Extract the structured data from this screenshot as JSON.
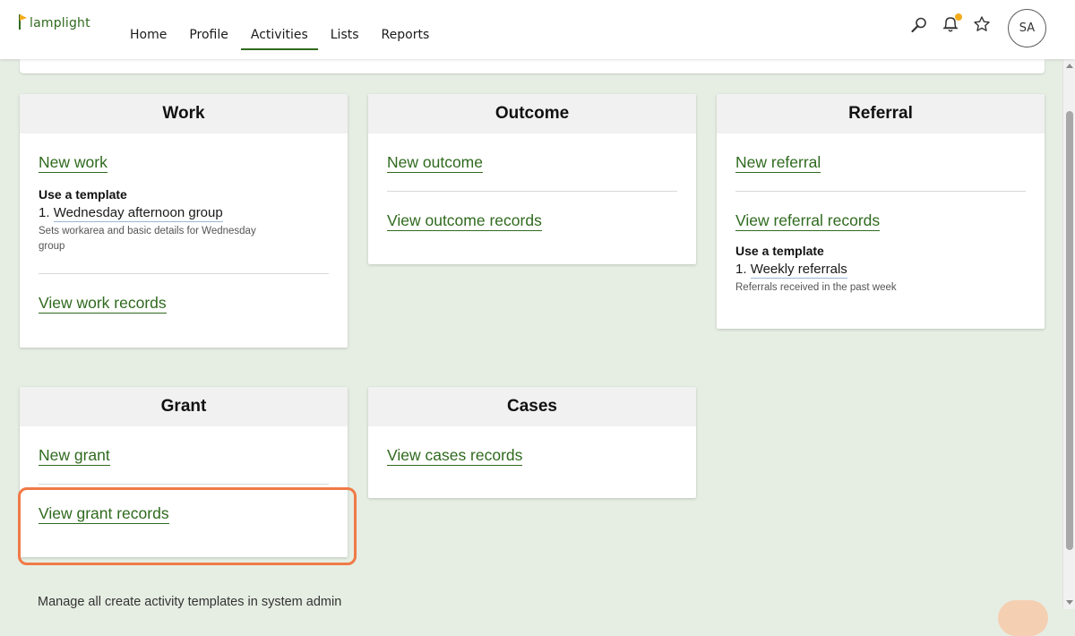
{
  "app": {
    "brand": "lamplight"
  },
  "nav": {
    "items": [
      {
        "label": "Home"
      },
      {
        "label": "Profile"
      },
      {
        "label": "Activities",
        "active": true
      },
      {
        "label": "Lists"
      },
      {
        "label": "Reports"
      }
    ]
  },
  "user": {
    "initials": "SA"
  },
  "colors": {
    "accent": "#2f6a1e",
    "background": "#e6eee3",
    "highlight": "#f07a47",
    "notification": "#f3ac1c"
  },
  "cards": {
    "work": {
      "title": "Work",
      "new_link": "New work",
      "template_heading": "Use a template",
      "template_number": "1.",
      "template_name": "Wednesday afternoon group",
      "template_desc": "Sets workarea and basic details for Wednesday group",
      "view_link": "View work records"
    },
    "outcome": {
      "title": "Outcome",
      "new_link": "New outcome",
      "view_link": "View outcome records"
    },
    "referral": {
      "title": "Referral",
      "new_link": "New referral",
      "view_link": "View referral records",
      "template_heading": "Use a template",
      "template_number": "1.",
      "template_name": "Weekly referrals",
      "template_desc": "Referrals received in the past week"
    },
    "grant": {
      "title": "Grant",
      "new_link": "New grant",
      "view_link": "View grant records"
    },
    "cases": {
      "title": "Cases",
      "view_link": "View cases records"
    }
  },
  "footer": {
    "note": "Manage all create activity templates in system admin"
  },
  "icons": {
    "search": "search-icon",
    "notifications": "bell-icon",
    "favourites": "star-icon"
  }
}
